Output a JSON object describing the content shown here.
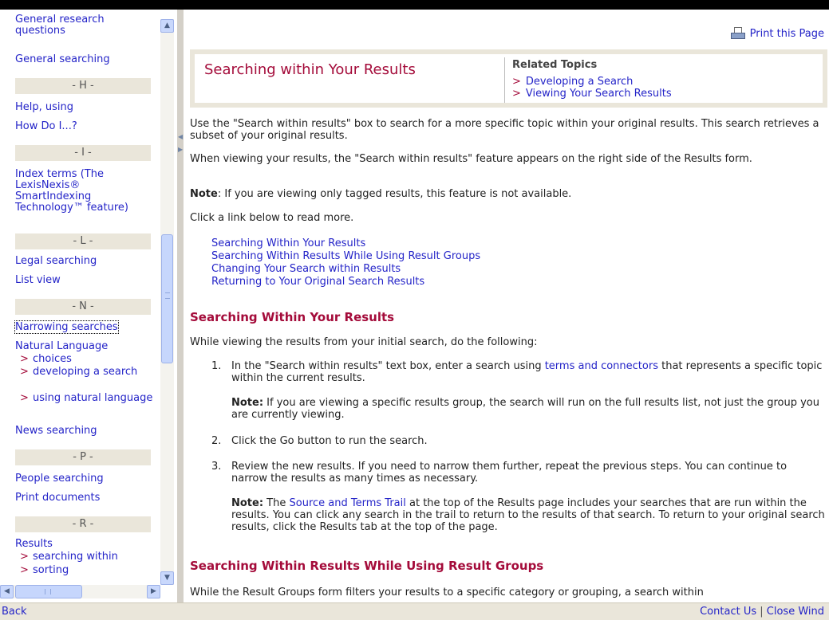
{
  "index": {
    "entries": [
      {
        "label": "General research questions"
      },
      {
        "label": "General searching"
      },
      {
        "label": "Help, using"
      },
      {
        "label": "How Do I...?"
      },
      {
        "label": "Index terms (The LexisNexis® SmartIndexing Technology™ feature)"
      },
      {
        "label": "Legal searching"
      },
      {
        "label": "List view"
      },
      {
        "label": "Narrowing searches"
      },
      {
        "label": "Natural Language"
      },
      {
        "label": "News searching"
      },
      {
        "label": "People searching"
      },
      {
        "label": "Print documents"
      },
      {
        "label": "Results"
      }
    ],
    "headings": [
      "- H -",
      "- I -",
      "- L -",
      "- N -",
      "- P -",
      "- R -"
    ],
    "natural_language_subitems": [
      "choices",
      "developing a search",
      "using natural language"
    ],
    "results_subitems": [
      "searching within",
      "sorting"
    ]
  },
  "content": {
    "print_label": "Print this Page",
    "title": "Searching within Your Results",
    "related_heading": "Related Topics",
    "related": [
      "Developing a Search",
      "Viewing Your Search Results"
    ],
    "intro1": "Use the \"Search within results\" box to search for a more specific topic within your original results. This search retrieves a subset of your original results.",
    "intro2": "When viewing your results, the \"Search within results\" feature appears on the right side of the Results form.",
    "note_label": "Note",
    "note_text": ": If you are viewing only tagged results, this feature is not available.",
    "click_text": "Click a link below to read more.",
    "toc": [
      "Searching Within Your Results",
      "Searching Within Results While Using Result Groups",
      "Changing Your Search within Results",
      "Returning to Your Original Search Results"
    ],
    "section1_title": "Searching Within Your Results",
    "section1_intro": "While viewing the results from your initial search, do the following:",
    "steps": [
      {
        "num": "1.",
        "pre": "In the \"Search within results\" text box, enter a search using ",
        "link": "terms and connectors",
        "post": " that represents a specific topic within the current results."
      },
      {
        "num": "2.",
        "text": "Click the Go button to run the search."
      },
      {
        "num": "3.",
        "text": "Review the new results. If you need to narrow them further, repeat the previous steps. You can continue to narrow the results as many times as necessary."
      }
    ],
    "note1_label": "Note:",
    "note1_text": " If you are viewing a specific results group, the search will run on the full results list, not just the group you are currently viewing.",
    "note2_label": "Note:",
    "note2_pre": " The ",
    "note2_link": "Source and Terms Trail",
    "note2_post": " at the top of the Results page includes your searches that are run within the results. You can click any search in the trail to return to the results of that search. To return to your original search results, click the Results tab at the top of the page.",
    "section2_title": "Searching Within Results While Using Result Groups",
    "section2_intro": "While the Result Groups form filters your results to a specific category or grouping, a search within"
  },
  "footer": {
    "back": "Back",
    "contact": "Contact Us",
    "separator": "|",
    "close": "Close Wind"
  },
  "colors": {
    "link": "#2424c8",
    "accent": "#a40b3a",
    "header_band": "#eae6da"
  },
  "icons": [
    "printer-icon",
    "chevron-right-icon",
    "scroll-up-icon",
    "scroll-down-icon",
    "scroll-left-icon",
    "scroll-right-icon"
  ]
}
